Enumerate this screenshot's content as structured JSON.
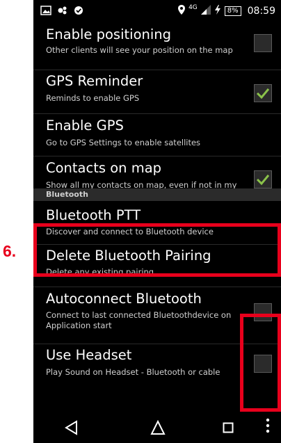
{
  "annotation": {
    "step_label": "6."
  },
  "status_bar": {
    "network": "4G",
    "battery": "8%",
    "time": "08:59"
  },
  "settings": [
    {
      "title": "Enable positioning",
      "subtitle": "Other clients will see your position on the map",
      "checkbox": true,
      "checked": false
    },
    {
      "title": "GPS Reminder",
      "subtitle": "Reminds to enable GPS",
      "checkbox": true,
      "checked": true
    },
    {
      "title": "Enable GPS",
      "subtitle": "Go to GPS Settings to enable satellites",
      "checkbox": false
    },
    {
      "title": "Contacts on map",
      "subtitle": "Show all my contacts on map, even if not in my group",
      "checkbox": true,
      "checked": true
    },
    {
      "title": "Bluetooth PTT",
      "subtitle": "Discover and connect to Bluetooth device",
      "checkbox": false
    },
    {
      "title": "Delete Bluetooth Pairing",
      "subtitle": "Delete any existing pairing",
      "checkbox": false
    },
    {
      "title": "Autoconnect Bluetooth",
      "subtitle": "Connect to last connected Bluetoothdevice on Application start",
      "checkbox": true,
      "checked": false
    },
    {
      "title": "Use Headset",
      "subtitle": "Play Sound on Headset - Bluetooth or cable",
      "checkbox": true,
      "checked": false
    }
  ],
  "section_header": "Bluetooth",
  "icons": {
    "status_left": [
      "gallery-icon",
      "app-notification-icon",
      "sync-icon"
    ],
    "status_right": [
      "location-icon",
      "signal-icon",
      "charging-icon"
    ],
    "nav": [
      "back-icon",
      "home-icon",
      "recents-icon",
      "overflow-menu-icon"
    ]
  },
  "colors": {
    "annotation": "#e8001c",
    "check": "#8bc34a",
    "background": "#000000",
    "section_header_bg": "#2b2b2b"
  }
}
